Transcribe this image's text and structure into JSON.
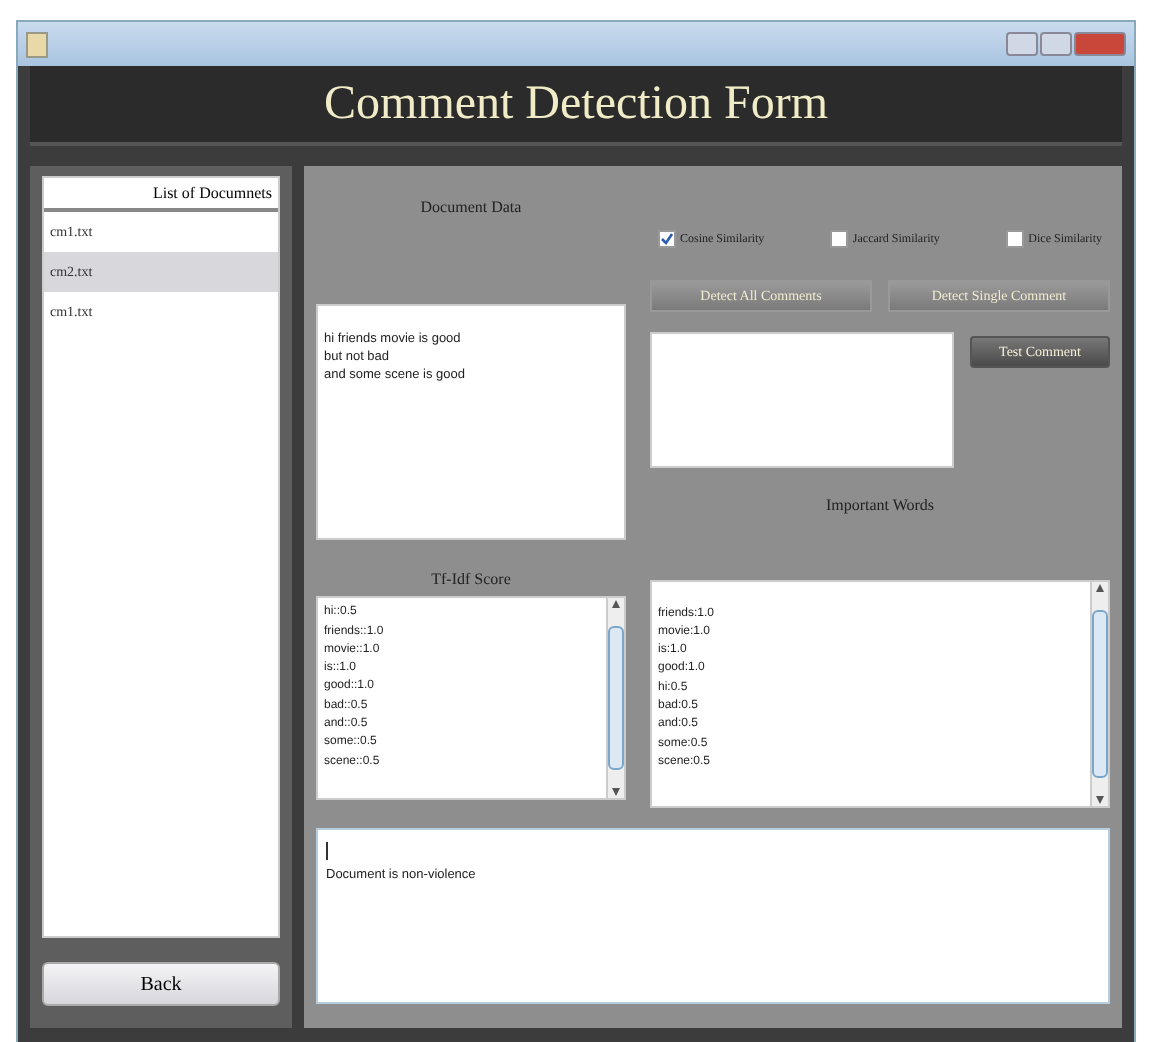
{
  "header": {
    "title": "Comment Detection Form"
  },
  "documents": {
    "title": "List of Documnets",
    "items": [
      {
        "label": "cm1.txt",
        "selected": false
      },
      {
        "label": "cm2.txt",
        "selected": true
      },
      {
        "label": "cm1.txt",
        "selected": false
      }
    ]
  },
  "back_button": "Back",
  "document_data": {
    "label": "Document Data",
    "lines": [
      "hi friends movie is good",
      "but not bad",
      "and some scene is good"
    ]
  },
  "similarity_options": [
    {
      "label": "Cosine Similarity",
      "checked": true
    },
    {
      "label": "Jaccard Similarity",
      "checked": false
    },
    {
      "label": "Dice Similarity",
      "checked": false
    }
  ],
  "action_buttons": [
    "Detect All Comments",
    "Detect Single Comment"
  ],
  "test_comment_button": "Test Comment",
  "important_words": {
    "label": "Important Words",
    "items": [
      "friends:1.0",
      "movie:1.0",
      "is:1.0",
      "good:1.0",
      "hi:0.5",
      "bad:0.5",
      "and:0.5",
      "some:0.5",
      "scene:0.5"
    ]
  },
  "tfidf": {
    "label": "Tf-Idf Score",
    "items": [
      "hi::0.5",
      "friends::1.0",
      "movie::1.0",
      "is::1.0",
      "good::1.0",
      "bad::0.5",
      "and::0.5",
      "some::0.5",
      "scene::0.5"
    ]
  },
  "output": {
    "text": "Document is non-violence"
  }
}
